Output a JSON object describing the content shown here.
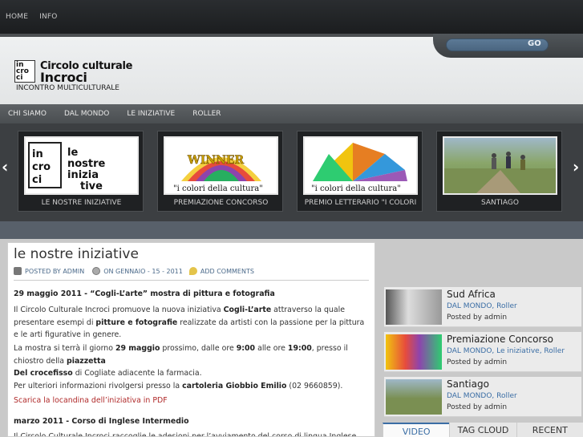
{
  "topnav": [
    "HOME",
    "INFO"
  ],
  "search": {
    "go_label": "GO"
  },
  "logo": {
    "box_text": "in cro ci",
    "line1": "Circolo culturale",
    "line2": "Incroci"
  },
  "tagline": "INCONTRO MULTICULTURALE",
  "mainnav": [
    "CHI SIAMO",
    "DAL MONDO",
    "LE INIZIATIVE",
    "ROLLER"
  ],
  "slider": {
    "prev": "‹",
    "next": "›",
    "slides": [
      {
        "caption": "LE NOSTRE INIZIATIVE",
        "img_text": "le nostre inizia tive"
      },
      {
        "caption": "PREMIAZIONE CONCORSO",
        "img_text": "WINNER"
      },
      {
        "caption": "PREMIO LETTERARIO \"I COLORI",
        "img_text": "\"i colori della cultura\""
      },
      {
        "caption": "SANTIAGO",
        "img_text": ""
      }
    ]
  },
  "post": {
    "title": "le nostre iniziative",
    "meta": {
      "author": "POSTED BY ADMIN",
      "date": "ON GENNAIO - 15 - 2011",
      "comments": "ADD COMMENTS"
    },
    "h1": "29 maggio 2011 - “Cogli-L’arte”  mostra di pittura e fotografia",
    "p1a": "Il Circolo Culturale Incroci promuove la nuova iniziativa ",
    "p1b": "Cogli-L’arte",
    "p1c": " attraverso la quale presentare esempi di ",
    "p1d": "pitture e fotografie",
    "p1e": " realizzate da artisti con la passione per la pittura e le arti figurative in genere.",
    "p2a": "La mostra si terrà il giorno ",
    "p2b": "29 maggio",
    "p2c": " prossimo, dalle ore ",
    "p2d": "9:00",
    "p2e": " alle ore ",
    "p2f": "19:00",
    "p2g": ",  presso il chiostro della ",
    "p2h": "piazzetta",
    "p2i": "Del crocefisso",
    "p2j": " di Cogliate adiacente la farmacia.",
    "p3a": "Per ulteriori informazioni rivolgersi presso la ",
    "p3b": "cartoleria Giobbio Emilio",
    "p3c": " (02 9660859).",
    "link": "Scarica la locandina dell’iniziativa in PDF",
    "h2": "marzo 2011 - Corso di Inglese Intermedio",
    "p4": "Il Circolo Culturale Incroci raccoglie le adesioni per l’avviamento del corso di lingua Inglese"
  },
  "sidebar": [
    {
      "title": "Sud Africa",
      "cats": "DAL MONDO, Roller",
      "by": "Posted by admin"
    },
    {
      "title": "Premiazione Concorso",
      "cats": "DAL MONDO, Le iniziative, Roller",
      "by": "Posted by admin"
    },
    {
      "title": "Santiago",
      "cats": "DAL MONDO, Roller",
      "by": "Posted by admin"
    }
  ],
  "tabs": [
    "VIDEO",
    "TAG CLOUD",
    "RECENT"
  ]
}
